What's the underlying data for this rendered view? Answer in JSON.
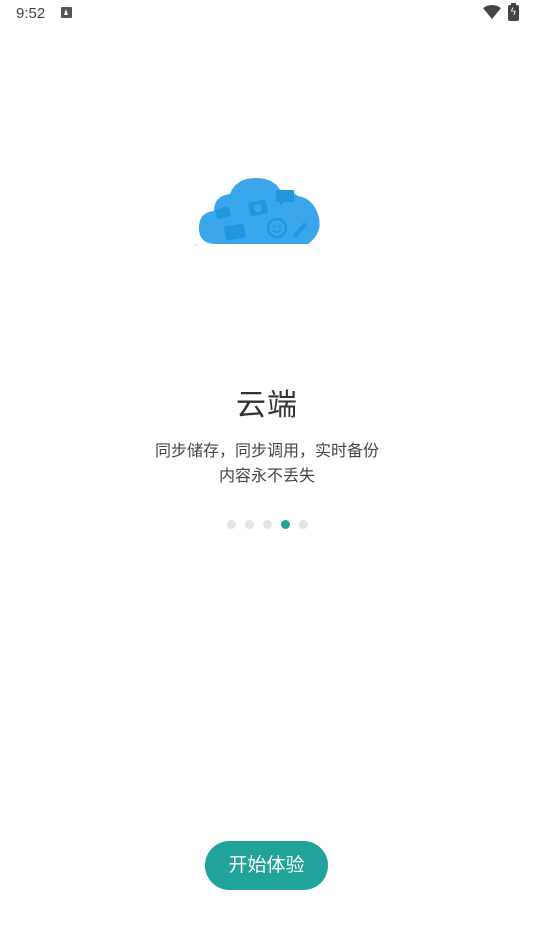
{
  "status_bar": {
    "time": "9:52",
    "notification_icon": "a-notification-icon",
    "wifi_icon": "wifi-icon",
    "battery_icon": "battery-charging-icon"
  },
  "onboarding": {
    "illustration": "cloud-icon",
    "title": "云端",
    "subtitle_line1": "同步储存，同步调用，实时备份",
    "subtitle_line2": "内容永不丢失",
    "pager": {
      "total": 5,
      "active_index": 3
    },
    "start_button_label": "开始体验"
  },
  "colors": {
    "accent": "#1fa39a",
    "cloud": "#3aa7ec",
    "cloud_shadow": "#2196e0",
    "dot_inactive": "#e3e3e3"
  }
}
